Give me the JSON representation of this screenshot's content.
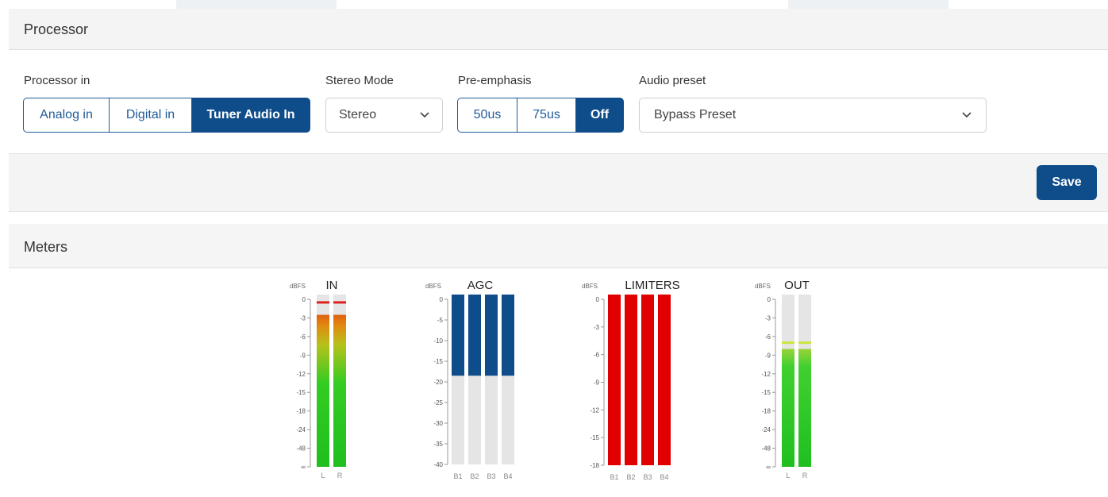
{
  "processor": {
    "title": "Processor",
    "processor_in": {
      "label": "Processor in",
      "options": [
        "Analog in",
        "Digital in",
        "Tuner Audio In"
      ],
      "selected": "Tuner Audio In"
    },
    "stereo_mode": {
      "label": "Stereo Mode",
      "value": "Stereo"
    },
    "pre_emphasis": {
      "label": "Pre-emphasis",
      "options": [
        "50us",
        "75us",
        "Off"
      ],
      "selected": "Off"
    },
    "audio_preset": {
      "label": "Audio preset",
      "value": "Bypass Preset"
    },
    "save_label": "Save"
  },
  "meters": {
    "title": "Meters",
    "unit": "dBFS",
    "in": {
      "title": "IN",
      "ticks": [
        "0",
        "-3",
        "-6",
        "-9",
        "-12",
        "-15",
        "-18",
        "-24",
        "-48",
        "∞"
      ],
      "channels": [
        {
          "label": "L",
          "level_db": -2.5,
          "peak_db": -0.5
        },
        {
          "label": "R",
          "level_db": -2.5,
          "peak_db": -0.5
        }
      ]
    },
    "agc": {
      "title": "AGC",
      "ticks": [
        "0",
        "-5",
        "-10",
        "-15",
        "-20",
        "-25",
        "-30",
        "-35",
        "-40"
      ],
      "bands": [
        {
          "label": "B1",
          "value_db": -18.5
        },
        {
          "label": "B2",
          "value_db": -18.5
        },
        {
          "label": "B3",
          "value_db": -18.5
        },
        {
          "label": "B4",
          "value_db": -18.5
        }
      ]
    },
    "limiters": {
      "title": "LIMITERS",
      "ticks": [
        "0",
        "-3",
        "-6",
        "-9",
        "-12",
        "-15",
        "-18"
      ],
      "bands": [
        {
          "label": "B1",
          "value_db": -18
        },
        {
          "label": "B2",
          "value_db": -18
        },
        {
          "label": "B3",
          "value_db": -18
        },
        {
          "label": "B4",
          "value_db": -18
        }
      ]
    },
    "out": {
      "title": "OUT",
      "ticks": [
        "0",
        "-3",
        "-6",
        "-9",
        "-12",
        "-15",
        "-18",
        "-24",
        "-48",
        "∞"
      ],
      "channels": [
        {
          "label": "L",
          "level_db": -8.0,
          "peak_db": -7.0
        },
        {
          "label": "R",
          "level_db": -8.0,
          "peak_db": -7.0
        }
      ]
    },
    "colors": {
      "agc_fill": "#0f4d8a",
      "limiter_fill": "#e00000",
      "meter_bg": "#e5e5e5",
      "peak_in": "#e02020",
      "peak_out": "#c8e63c"
    }
  }
}
